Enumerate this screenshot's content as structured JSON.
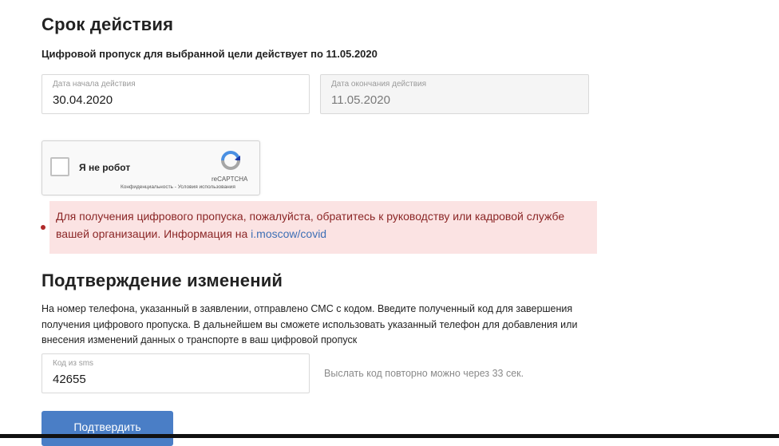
{
  "validity": {
    "title": "Срок действия",
    "subtitle": "Цифровой пропуск для выбранной цели действует по 11.05.2020",
    "start_label": "Дата начала действия",
    "start_value": "30.04.2020",
    "end_label": "Дата окончания действия",
    "end_value": "11.05.2020"
  },
  "captcha": {
    "label": "Я не робот",
    "brand": "reCAPTCHA",
    "links": "Конфиденциальность - Условия использования",
    "checked": false
  },
  "alert": {
    "text": "Для получения цифрового пропуска, пожалуйста, обратитесь к руководству или кадровой службе вашей организации. Информация на",
    "link_text": "i.moscow/covid"
  },
  "confirm": {
    "title": "Подтверждение изменений",
    "description": "На номер телефона, указанный в заявлении, отправлено СМС с кодом. Введите полученный код для завершения получения цифрового пропуска. В дальнейшем вы сможете использовать указанный телефон для добавления или внесения изменений данных о транспорте в ваш цифровой пропуск",
    "code_label": "Код из sms",
    "code_value": "42655",
    "resend_text": "Выслать код повторно можно через 33 сек.",
    "button_label": "Подтвердить"
  },
  "colors": {
    "primary_button": "#4a7ec6",
    "alert_bg": "#fbe3e3",
    "alert_text": "#8b2626",
    "link": "#3d6fb5"
  }
}
